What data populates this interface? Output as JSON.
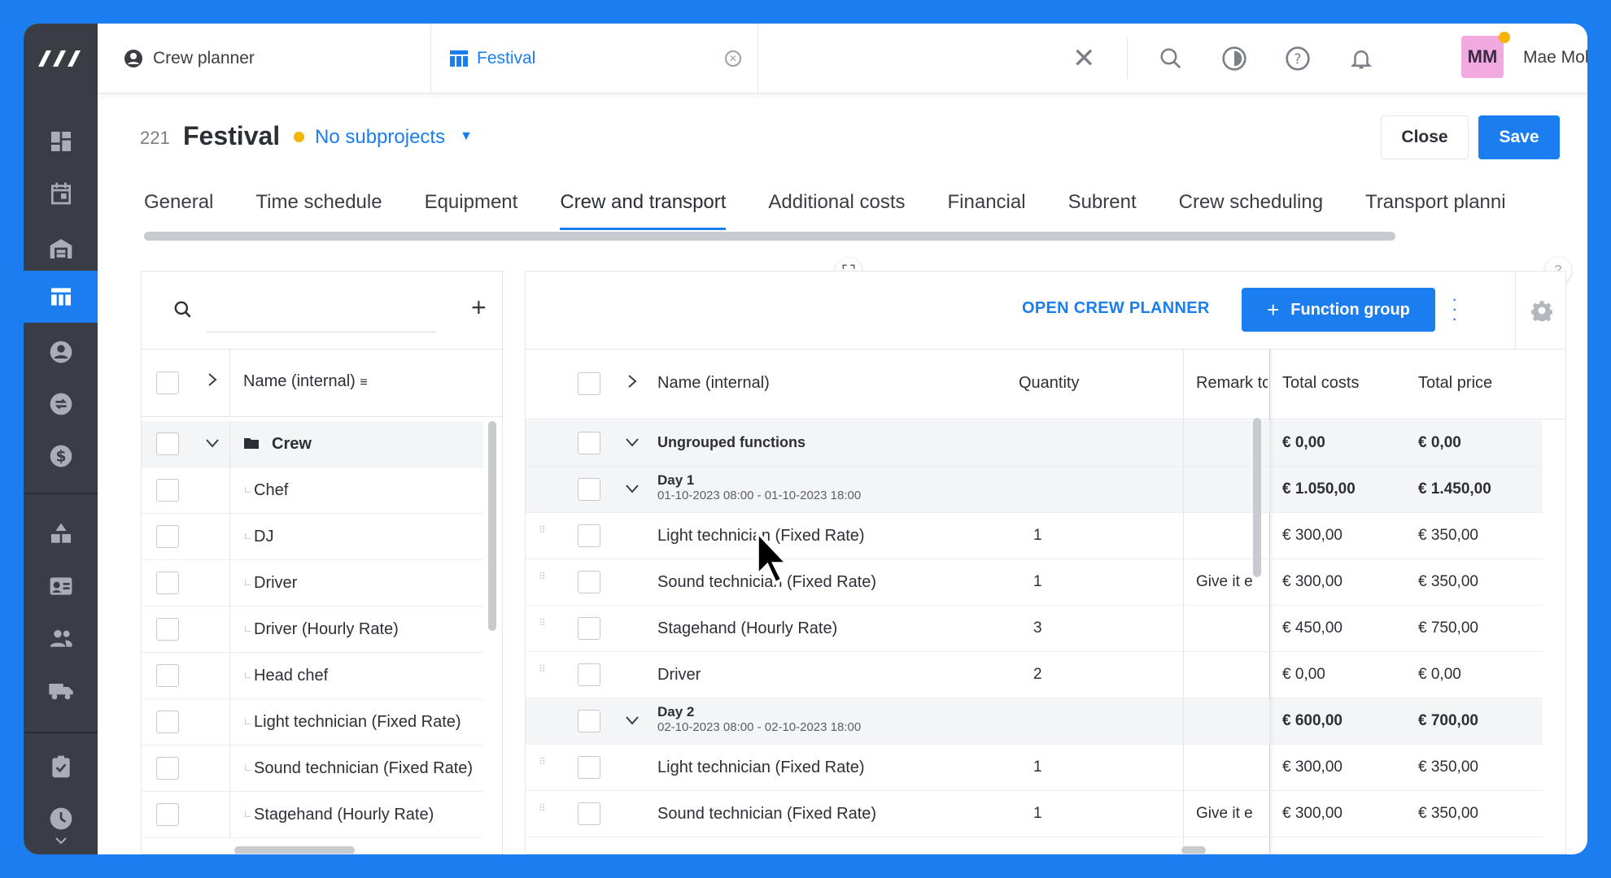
{
  "topbar": {
    "tabs": [
      {
        "label": "Crew planner",
        "icon": "user-circle-icon"
      },
      {
        "label": "Festival",
        "icon": "table-icon",
        "active": true
      }
    ],
    "user": {
      "initials": "MM",
      "name": "Mae Mohammadi"
    }
  },
  "project": {
    "number": "221",
    "title": "Festival",
    "subprojects": "No subprojects",
    "close_label": "Close",
    "save_label": "Save"
  },
  "tabs": [
    "General",
    "Time schedule",
    "Equipment",
    "Crew and transport",
    "Additional costs",
    "Financial",
    "Subrent",
    "Crew scheduling",
    "Transport planni"
  ],
  "active_tab": "Crew and transport",
  "left_panel": {
    "header": "Name (internal)",
    "group": "Crew",
    "items": [
      "Chef",
      "DJ",
      "Driver",
      "Driver (Hourly Rate)",
      "Head chef",
      "Light technician (Fixed Rate)",
      "Sound technician (Fixed Rate)",
      "Stagehand (Hourly Rate)"
    ]
  },
  "right_panel": {
    "open_crew_planner": "OPEN CREW PLANNER",
    "function_group": "Function group",
    "columns": {
      "name": "Name (internal)",
      "quantity": "Quantity",
      "remark": "Remark to",
      "total_costs": "Total costs",
      "total_price": "Total price"
    },
    "rows": [
      {
        "kind": "group",
        "name": "Ungrouped functions",
        "cost": "€ 0,00",
        "price": "€ 0,00"
      },
      {
        "kind": "day",
        "name": "Day 1",
        "date": "01-10-2023 08:00 - 01-10-2023 18:00",
        "cost": "€ 1.050,00",
        "price": "€ 1.450,00"
      },
      {
        "kind": "item",
        "name": "Light technician (Fixed Rate)",
        "qty": "1",
        "remark": "",
        "cost": "€ 300,00",
        "price": "€ 350,00"
      },
      {
        "kind": "item",
        "name": "Sound technician (Fixed Rate)",
        "qty": "1",
        "remark": "Give it e",
        "cost": "€ 300,00",
        "price": "€ 350,00"
      },
      {
        "kind": "item",
        "name": "Stagehand (Hourly Rate)",
        "qty": "3",
        "remark": "",
        "cost": "€ 450,00",
        "price": "€ 750,00"
      },
      {
        "kind": "item",
        "name": "Driver",
        "qty": "2",
        "remark": "",
        "cost": "€ 0,00",
        "price": "€ 0,00"
      },
      {
        "kind": "day",
        "name": "Day 2",
        "date": "02-10-2023 08:00 - 02-10-2023 18:00",
        "cost": "€ 600,00",
        "price": "€ 700,00"
      },
      {
        "kind": "item",
        "name": "Light technician (Fixed Rate)",
        "qty": "1",
        "remark": "",
        "cost": "€ 300,00",
        "price": "€ 350,00"
      },
      {
        "kind": "item",
        "name": "Sound technician (Fixed Rate)",
        "qty": "1",
        "remark": "Give it e",
        "cost": "€ 300,00",
        "price": "€ 350,00"
      }
    ]
  },
  "colors": {
    "accent": "#1a7ef0",
    "sidebar": "#3a3d44",
    "status_dot": "#f5b400",
    "avatar_bg": "#f2a9e0"
  },
  "sidebar_icons": [
    "dashboard-icon",
    "calendar-icon",
    "warehouse-icon",
    "projects-table-icon",
    "contacts-icon",
    "swap-icon",
    "finance-icon",
    "inventory-icon",
    "crew-card-icon",
    "team-icon",
    "truck-icon",
    "tasks-icon",
    "clock-icon"
  ]
}
